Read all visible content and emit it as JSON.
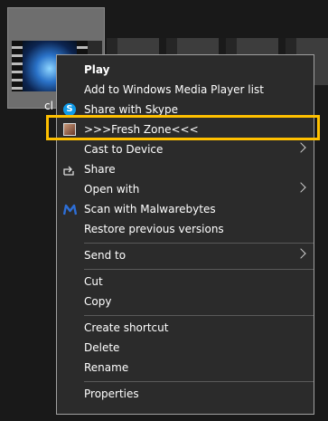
{
  "file": {
    "label": "cl"
  },
  "menu": {
    "items": [
      {
        "label": "Play",
        "bold": true
      },
      {
        "label": "Add to Windows Media Player list"
      },
      {
        "label": "Share with Skype",
        "icon": "skype-icon"
      },
      {
        "label": ">>>Fresh Zone<<<",
        "icon": "avatar-icon"
      },
      {
        "label": "Cast to Device",
        "submenu": true
      },
      {
        "label": "Share",
        "icon": "share-icon"
      },
      {
        "label": "Open with",
        "submenu": true
      },
      {
        "label": "Scan with Malwarebytes",
        "icon": "malwarebytes-icon"
      },
      {
        "label": "Restore previous versions"
      },
      {
        "label": "Send to",
        "submenu": true
      },
      {
        "label": "Cut"
      },
      {
        "label": "Copy"
      },
      {
        "label": "Create shortcut"
      },
      {
        "label": "Delete"
      },
      {
        "label": "Rename"
      },
      {
        "label": "Properties"
      }
    ]
  },
  "colors": {
    "highlight": "#ffc000",
    "menu_bg": "#2b2b2b",
    "skype": "#0f9ae8",
    "malwarebytes": "#2d6ed6"
  }
}
